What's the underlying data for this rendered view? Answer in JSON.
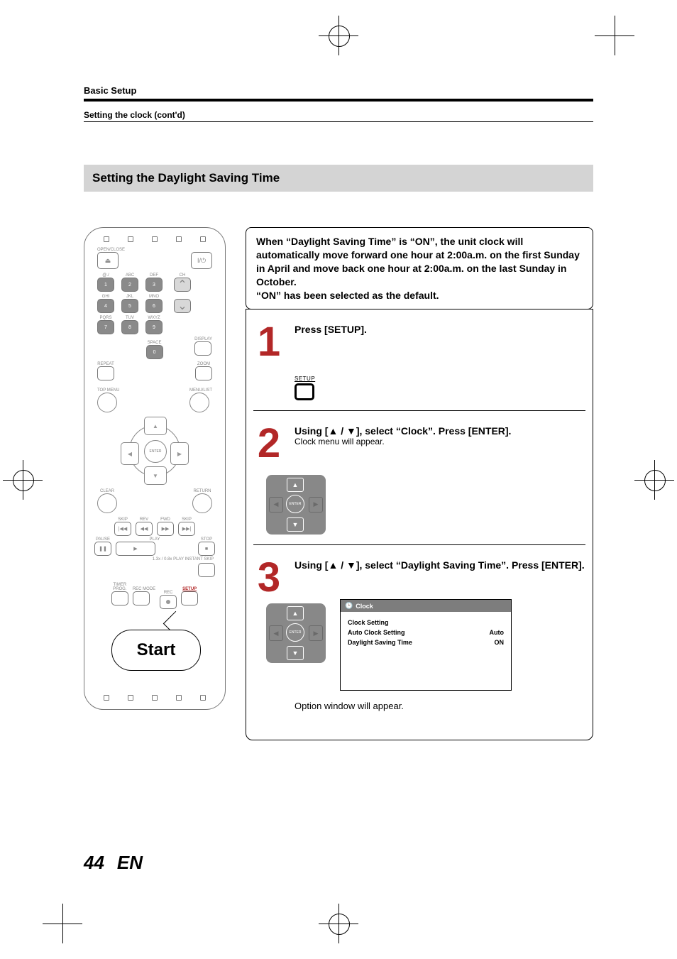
{
  "header": {
    "section": "Basic Setup",
    "subsection": "Setting the clock (cont'd)"
  },
  "section_title": "Setting the Daylight Saving Time",
  "remote": {
    "open_close": "OPEN/CLOSE",
    "power": "I/⏻",
    "row1_lbl": [
      "@./",
      "ABC",
      "DEF"
    ],
    "row1_num": [
      "1",
      "2",
      "3"
    ],
    "row2_lbl": [
      "GHI",
      "JKL",
      "MNO"
    ],
    "row2_num": [
      "4",
      "5",
      "6"
    ],
    "row3_lbl": [
      "PQRS",
      "TUV",
      "WXYZ"
    ],
    "row3_num": [
      "7",
      "8",
      "9"
    ],
    "space": "SPACE",
    "zero": "0",
    "display": "DISPLAY",
    "ch": "CH",
    "repeat": "REPEAT",
    "zoom": "ZOOM",
    "top_menu": "TOP MENU",
    "menu_list": "MENU/LIST",
    "enter": "ENTER",
    "clear": "CLEAR",
    "return": "RETURN",
    "skip_l": "SKIP",
    "rev": "REV",
    "fwd": "FWD",
    "skip_r": "SKIP",
    "pause": "PAUSE",
    "play": "PLAY",
    "stop": "STOP",
    "bottom_hint": "1.3x / 0.8x PLAY   INSTANT SKIP",
    "timer": "TIMER\nPROG.",
    "recmode": "REC MODE",
    "rec": "REC",
    "setup": "SETUP",
    "bubble": "Start"
  },
  "intro": "When “Daylight Saving Time” is “ON”, the unit clock will automatically move forward one hour at 2:00a.m. on the first Sunday in April and move back one hour at 2:00a.m. on the last Sunday in October.\n“ON” has been selected as the default.",
  "steps": [
    {
      "num": "1",
      "title": "Press [SETUP].",
      "sub": "",
      "setup_label": "SETUP"
    },
    {
      "num": "2",
      "title": "Using [▲ / ▼], select “Clock”. Press [ENTER].",
      "sub": "Clock menu will appear.",
      "enter": "ENTER"
    },
    {
      "num": "3",
      "title": "Using [▲ / ▼], select “Daylight Saving Time”. Press [ENTER].",
      "enter": "ENTER",
      "osd_title": "Clock",
      "osd_rows": [
        {
          "label": "Clock Setting",
          "value": ""
        },
        {
          "label": "Auto Clock Setting",
          "value": "Auto"
        },
        {
          "label": "Daylight Saving Time",
          "value": "ON"
        }
      ],
      "footnote": "Option window will appear."
    }
  ],
  "footer": {
    "page": "44",
    "lang": "EN"
  }
}
